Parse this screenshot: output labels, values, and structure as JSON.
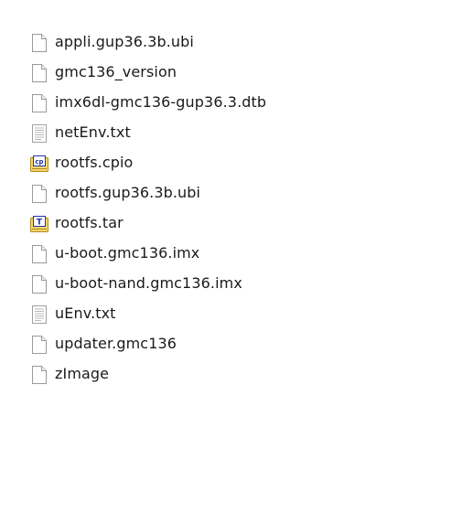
{
  "file_list": {
    "items": [
      {
        "name": "appli.gup36.3b.ubi",
        "icon": "blank-file-icon"
      },
      {
        "name": "gmc136_version",
        "icon": "blank-file-icon"
      },
      {
        "name": "imx6dl-gmc136-gup36.3.dtb",
        "icon": "blank-file-icon"
      },
      {
        "name": "netEnv.txt",
        "icon": "text-file-icon"
      },
      {
        "name": "rootfs.cpio",
        "icon": "cpio-archive-icon",
        "icon_label": "cp"
      },
      {
        "name": "rootfs.gup36.3b.ubi",
        "icon": "blank-file-icon"
      },
      {
        "name": "rootfs.tar",
        "icon": "tar-archive-icon",
        "icon_label": "T"
      },
      {
        "name": "u-boot.gmc136.imx",
        "icon": "blank-file-icon"
      },
      {
        "name": "u-boot-nand.gmc136.imx",
        "icon": "blank-file-icon"
      },
      {
        "name": "uEnv.txt",
        "icon": "text-file-icon"
      },
      {
        "name": "updater.gmc136",
        "icon": "blank-file-icon"
      },
      {
        "name": "zImage",
        "icon": "blank-file-icon"
      }
    ]
  },
  "colors": {
    "text": "#1a1a1a",
    "file_outline": "#9a9a9a",
    "archive_yellow": "#f5d76e",
    "archive_badge": "#2233aa"
  }
}
